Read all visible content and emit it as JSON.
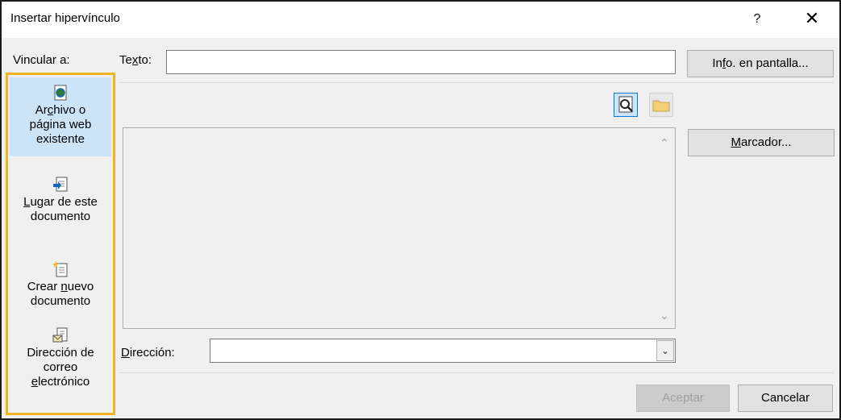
{
  "window": {
    "title": "Insertar hipervínculo",
    "help": "?",
    "close": "✕"
  },
  "link_to": {
    "label": "Vincular a:",
    "items": [
      {
        "line1_pre": "Ar",
        "line1_u": "c",
        "line1_post": "hivo o",
        "line2": "página web",
        "line3": "existente",
        "icon": "web-page-icon",
        "selected": true
      },
      {
        "line1_pre": "",
        "line1_u": "L",
        "line1_post": "ugar de este",
        "line2": "documento",
        "icon": "place-in-document-icon",
        "selected": false
      },
      {
        "line1_pre": "Crear ",
        "line1_u": "n",
        "line1_post": "uevo",
        "line2": "documento",
        "icon": "new-document-icon",
        "selected": false
      },
      {
        "line1": "Dirección de",
        "line2": "correo",
        "line3_u": "e",
        "line3_post": "lectrónico",
        "icon": "email-icon",
        "selected": false
      }
    ],
    "highlight_color": "#f2b421"
  },
  "texto": {
    "label_pre": "Te",
    "label_u": "x",
    "label_post": "to:",
    "value": ""
  },
  "buttons": {
    "info_pre": "In",
    "info_u": "f",
    "info_post": "o. en pantalla...",
    "marcador_u": "M",
    "marcador_post": "arcador...",
    "aceptar": "Aceptar",
    "cancelar": "Cancelar"
  },
  "direccion": {
    "label_u": "D",
    "label_post": "irección:",
    "value": ""
  },
  "toolbar": {
    "browse_web_icon": "browse-web-icon",
    "browse_file_icon": "folder-icon"
  }
}
